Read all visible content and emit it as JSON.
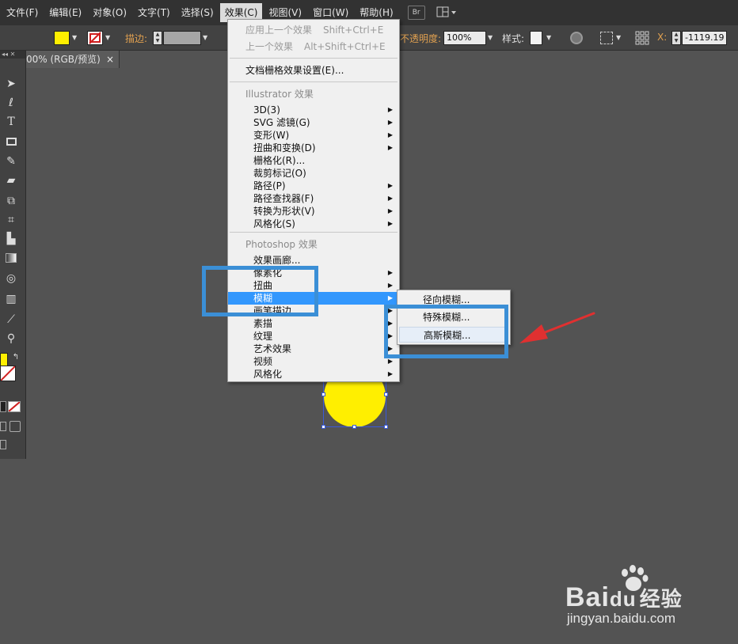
{
  "menubar": {
    "items": [
      "文件(F)",
      "编辑(E)",
      "对象(O)",
      "文字(T)",
      "选择(S)",
      "效果(C)",
      "视图(V)",
      "窗口(W)",
      "帮助(H)"
    ],
    "bridge_label": "Br"
  },
  "controlbar": {
    "stroke_label": "描边:",
    "opacity_label": "不透明度:",
    "opacity_value": "100%",
    "style_label": "样式:",
    "x_label": "X:",
    "x_value": "-1119.19"
  },
  "document_tab": {
    "title": "00% (RGB/预览)",
    "close": "×"
  },
  "effect_menu": {
    "apply_last": "应用上一个效果",
    "apply_last_shortcut": "Shift+Ctrl+E",
    "last_effect": "上一个效果",
    "last_effect_shortcut": "Alt+Shift+Ctrl+E",
    "raster_settings": "文档栅格效果设置(E)...",
    "illustrator_section": "Illustrator 效果",
    "illustrator_items": [
      "3D(3)",
      "SVG 滤镜(G)",
      "变形(W)",
      "扭曲和变换(D)",
      "栅格化(R)...",
      "裁剪标记(O)",
      "路径(P)",
      "路径查找器(F)",
      "转换为形状(V)",
      "风格化(S)"
    ],
    "photoshop_section": "Photoshop 效果",
    "photoshop_items": [
      "效果画廊...",
      "像素化",
      "扭曲",
      "模糊",
      "画笔描边",
      "素描",
      "纹理",
      "艺术效果",
      "视频",
      "风格化"
    ]
  },
  "blur_submenu": {
    "items": [
      "径向模糊...",
      "特殊模糊...",
      "高斯模糊..."
    ]
  },
  "watermark": {
    "brand": "Bai",
    "brand_du": "du",
    "brand_cn": "经验",
    "url": "jingyan.baidu.com"
  },
  "colors": {
    "fill": "#ffef00",
    "highlight": "#3297fd",
    "annotation": "#3b8fd6",
    "arrow": "#e03030"
  }
}
